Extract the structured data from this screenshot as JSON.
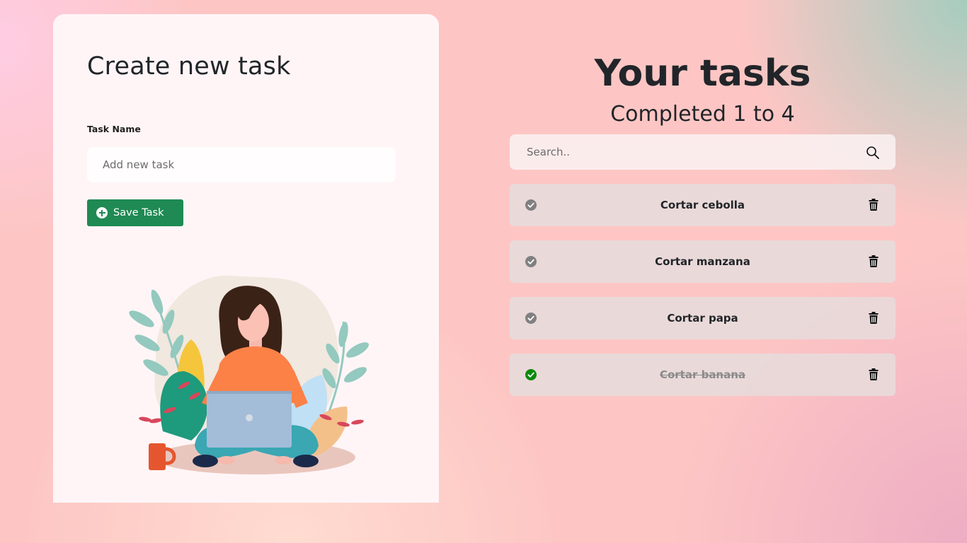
{
  "create_panel": {
    "title": "Create new task",
    "field_label": "Task Name",
    "input_placeholder": "Add new task",
    "input_value": "",
    "save_button_label": "Save Task",
    "save_button_color": "#1f8a53"
  },
  "tasks_panel": {
    "title": "Your tasks",
    "summary": "Completed 1 to 4",
    "search_placeholder": "Search..",
    "search_icon": "search-icon"
  },
  "tasks": [
    {
      "name": "Cortar cebolla",
      "completed": false
    },
    {
      "name": "Cortar manzana",
      "completed": false
    },
    {
      "name": "Cortar papa",
      "completed": false
    },
    {
      "name": "Cortar banana",
      "completed": true
    }
  ],
  "colors": {
    "completed_check": "#0b8a0b",
    "pending_check": "#808080",
    "primary_button": "#1f8a53"
  }
}
